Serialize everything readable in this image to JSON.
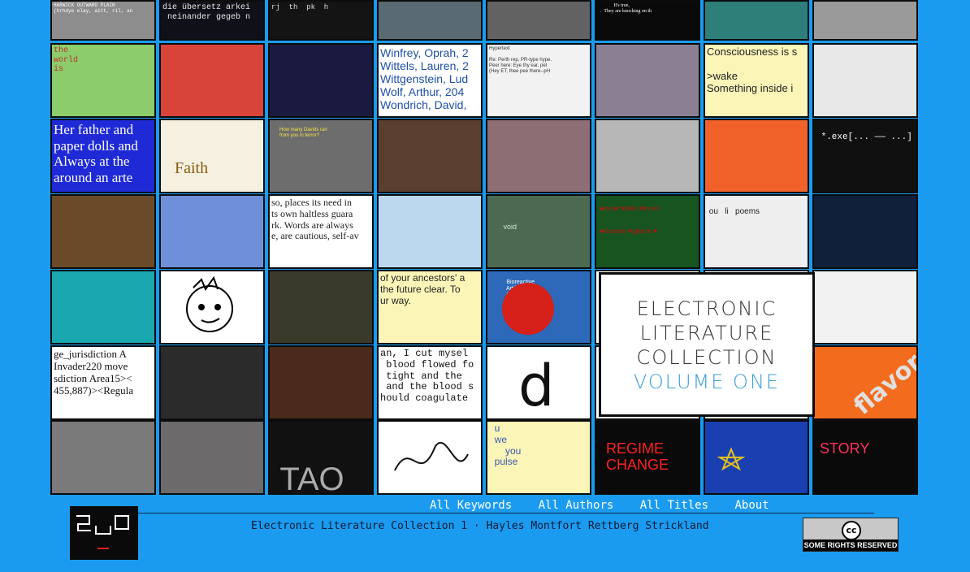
{
  "feature": {
    "line1": "ELECTRONIC",
    "line2": "LITERATURE",
    "line3": "COLLECTION",
    "line4": "VOLUME ONE",
    "accent": "#3aa0d8"
  },
  "nav": {
    "keywords": "All Keywords",
    "authors": "All Authors",
    "titles": "All Titles",
    "about": "About"
  },
  "credit": "Electronic Literature Collection 1 · Hayles Montfort Rettberg Strickland",
  "license": {
    "label": "SOME RIGHTS RESERVED",
    "symbol": "cc"
  },
  "logo_name": "eli-logo",
  "tiles": [
    {
      "bg": "#8d8d8d",
      "fg": "#ffffff",
      "text": "HARWICK OUTWARD PLAIN\n(hrhdye elay, aitt, ril, an",
      "cls": "mono",
      "size": 6
    },
    {
      "bg": "#101018",
      "fg": "#e8e8e8",
      "text": "die übersetz arkei\n neinander gegeb n",
      "cls": "mono",
      "size": 10
    },
    {
      "bg": "#141414",
      "fg": "#dcdcdc",
      "text": "rj  th  pk  h  ",
      "cls": "mono",
      "size": 9
    },
    {
      "bg": "#5a6a72",
      "fg": "#ffffff",
      "text": "",
      "cls": "sans",
      "size": 8
    },
    {
      "bg": "#626262",
      "fg": "#ffffff",
      "text": "",
      "cls": "sans",
      "size": 8
    },
    {
      "bg": "#0a0a0a",
      "fg": "#ffffff",
      "text": "             It's true,\n  .  They are knocking on th",
      "cls": "serif",
      "size": 6
    },
    {
      "bg": "#2e7f7a",
      "fg": "#ffffff",
      "text": "",
      "cls": "sans",
      "size": 8
    },
    {
      "bg": "#9a9a9a",
      "fg": "#ffffff",
      "text": "",
      "cls": "sans",
      "size": 8
    },
    {
      "bg": "#8ccc6a",
      "fg": "#c03030",
      "text": "the\nworld\nis",
      "cls": "mono",
      "size": 10
    },
    {
      "bg": "#d9443a",
      "fg": "#ffffff",
      "text": "",
      "cls": "sans",
      "size": 8
    },
    {
      "bg": "#1a1a40",
      "fg": "#c0c0c0",
      "text": "",
      "cls": "sans",
      "size": 8
    },
    {
      "bg": "#ffffff",
      "fg": "#1f4fa8",
      "text": "Winfrey, Oprah, 2\nWittels, Lauren, 2\nWittgenstein, Lud\nWolf, Arthur, 204\nWondrich, David,",
      "cls": "sans",
      "size": 14
    },
    {
      "bg": "#f2f2f2",
      "fg": "#333333",
      "text": "Hypertext\n\nRe: Perth rep, PR-type hype.\nPeer here: Eye thy ear, pet\n(Hey ET, thee pee there--pH",
      "cls": "sans",
      "size": 6
    },
    {
      "bg": "#8a7f93",
      "fg": "#ffffff",
      "text": "",
      "cls": "sans",
      "size": 8
    },
    {
      "bg": "#fbf5b8",
      "fg": "#222222",
      "text": "Consciousness is s\n\n>wake\nSomething inside i",
      "cls": "sans",
      "size": 13
    },
    {
      "bg": "#e8e8e8",
      "fg": "#000000",
      "text": "",
      "cls": "sans",
      "size": 8
    },
    {
      "bg": "#1f2ad6",
      "fg": "#ffffff",
      "text": "Her father and\npaper dolls and\nAlways at the\naround an arte",
      "cls": "serif",
      "size": 17
    },
    {
      "bg": "#f5f0e0",
      "fg": "#8a5c12",
      "text": "\n\n   Faith",
      "cls": "serif",
      "size": 20
    },
    {
      "bg": "#6d6d6d",
      "fg": "#f5e34a",
      "text": "\n      How many Davids ran\n      from you in terror?",
      "cls": "sans",
      "size": 6
    },
    {
      "bg": "#5a3e2e",
      "fg": "#ffffff",
      "text": "",
      "cls": "sans",
      "size": 8
    },
    {
      "bg": "#8d6e75",
      "fg": "#ffffff",
      "text": "",
      "cls": "sans",
      "size": 8
    },
    {
      "bg": "#b7b7b7",
      "fg": "#ffffff",
      "text": "",
      "cls": "sans",
      "size": 8
    },
    {
      "bg": "#f0622a",
      "fg": "#ffffff",
      "text": "",
      "cls": "sans",
      "size": 8
    },
    {
      "bg": "#101010",
      "fg": "#ffffff",
      "text": "\n *.exe[... —— ...]",
      "cls": "mono",
      "size": 11
    },
    {
      "bg": "#6b4a2a",
      "fg": "#ffffff",
      "text": "",
      "cls": "sans",
      "size": 8
    },
    {
      "bg": "#6f8fd8",
      "fg": "#ffffff",
      "text": "",
      "cls": "sans",
      "size": 8
    },
    {
      "bg": "#ffffff",
      "fg": "#222222",
      "text": "so, places its need in\nts own haltless guara\nrk. Words are always\ne, are cautious, self-av",
      "cls": "serif",
      "size": 12
    },
    {
      "bg": "#bcd8ee",
      "fg": "#ffffff",
      "text": "",
      "cls": "sans",
      "size": 8
    },
    {
      "bg": "#4c6a52",
      "fg": "#cfe8cf",
      "text": "\n\n\n       void",
      "cls": "sans",
      "size": 9
    },
    {
      "bg": "#17541f",
      "fg": "#c01010",
      "text": "\n ♣musk ♥dark ♥incen\n\n\n ♣incense ♥glance ♥",
      "cls": "sans",
      "size": 8
    },
    {
      "bg": "#eeeeee",
      "fg": "#222222",
      "text": "\n ou   li   poems\n\n\n",
      "cls": "sans",
      "size": 10
    },
    {
      "bg": "#10203a",
      "fg": "#ffffff",
      "text": "",
      "cls": "sans",
      "size": 8
    },
    {
      "bg": "#1aa7b0",
      "fg": "#ffffff",
      "text": "",
      "cls": "sans",
      "size": 8
    },
    {
      "bg": "#ffffff",
      "fg": "#000000",
      "text": "",
      "cls": "sans",
      "size": 8
    },
    {
      "bg": "#3a3a2a",
      "fg": "#ffffff",
      "text": "",
      "cls": "sans",
      "size": 8
    },
    {
      "bg": "#fbf5b8",
      "fg": "#222222",
      "text": "of your ancestors' a\nthe future clear. To\nur way.",
      "cls": "sans",
      "size": 12
    },
    {
      "bg": "#2d69b8",
      "fg": "#ffffff",
      "text": "\n           Bioreactive\n           Artificial\n           Learning\n           Lifeform",
      "cls": "sans",
      "size": 7
    },
    {
      "bg": "#ffffff",
      "fg": "#ffffff",
      "text": "",
      "cls": "sans",
      "size": 8
    },
    {
      "bg": "#ffffff",
      "fg": "#ffffff",
      "text": "",
      "cls": "sans",
      "size": 8
    },
    {
      "bg": "#f2f2f2",
      "fg": "#333333",
      "text": "",
      "cls": "sans",
      "size": 8
    },
    {
      "bg": "#ffffff",
      "fg": "#111111",
      "text": "ge_jurisdiction A\nInvader220 move\nsdiction Area15><\n455,887)><Regula",
      "cls": "serif",
      "size": 13
    },
    {
      "bg": "#2b2b2b",
      "fg": "#ffffff",
      "text": "",
      "cls": "sans",
      "size": 8
    },
    {
      "bg": "#4a2a1a",
      "fg": "#ffffff",
      "text": "",
      "cls": "sans",
      "size": 8
    },
    {
      "bg": "#ffffff",
      "fg": "#111111",
      "text": "an, I cut mysel\n blood flowed fo\n tight and the\n and the blood s\nhould coagulate",
      "cls": "mono",
      "size": 12
    },
    {
      "bg": "#ffffff",
      "fg": "#111111",
      "text": "",
      "cls": "sans",
      "size": 8
    },
    {
      "bg": "#ffffff",
      "fg": "#ffffff",
      "text": "",
      "cls": "sans",
      "size": 8
    },
    {
      "bg": "#ffffff",
      "fg": "#ffffff",
      "text": "",
      "cls": "sans",
      "size": 8
    },
    {
      "bg": "#f36b1c",
      "fg": "#ffffff",
      "text": "",
      "cls": "sans",
      "size": 8
    },
    {
      "bg": "#7a7a7a",
      "fg": "#ffffff",
      "text": "",
      "cls": "sans",
      "size": 8
    },
    {
      "bg": "#6c6a6a",
      "fg": "#ffffff",
      "text": "",
      "cls": "sans",
      "size": 8
    },
    {
      "bg": "#111111",
      "fg": "#aaaaaa",
      "text": "\n TAO",
      "cls": "sans",
      "size": 40
    },
    {
      "bg": "#ffffff",
      "fg": "#111111",
      "text": "",
      "cls": "sans",
      "size": 8
    },
    {
      "bg": "#fbf5b8",
      "fg": "#3a5aa8",
      "text": "  u\n  we\n      you\n  pulse",
      "cls": "sans",
      "size": 12
    },
    {
      "bg": "#0a0a0a",
      "fg": "#ff2020",
      "text": "\n  REGIME\n  CHANGE",
      "cls": "sans",
      "size": 18
    },
    {
      "bg": "#1a3fb0",
      "fg": "#e8c21a",
      "text": "",
      "cls": "sans",
      "size": 8
    },
    {
      "bg": "#0a0a0a",
      "fg": "#ff3060",
      "text": "\n STORY",
      "cls": "sans",
      "size": 18
    }
  ],
  "captions": {
    "faith": "Faith",
    "d_letter": "d",
    "you": "you",
    "tao": "TAO"
  }
}
